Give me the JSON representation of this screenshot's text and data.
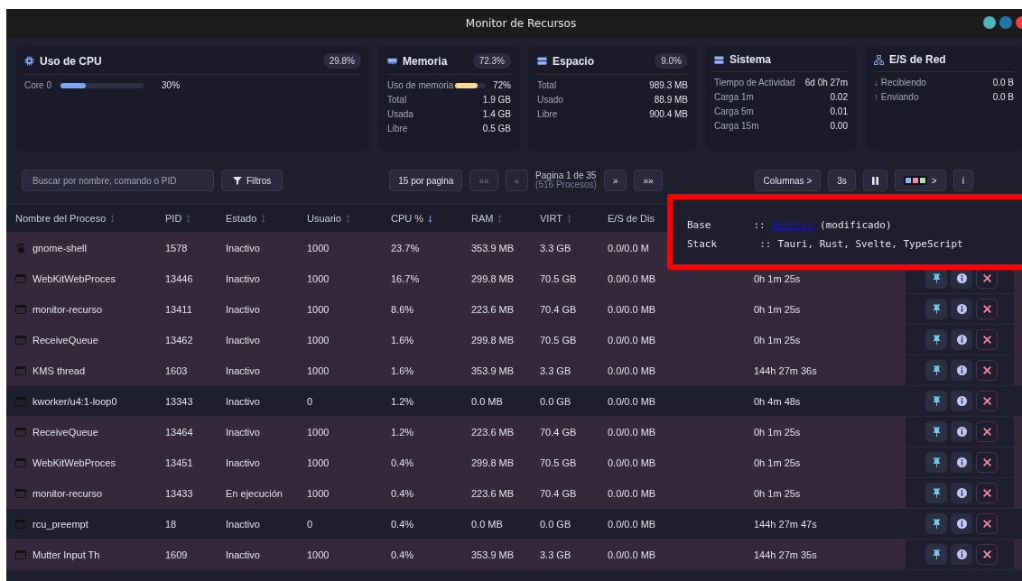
{
  "window": {
    "title": "Monitor de Recursos",
    "controls": [
      {
        "color": "#4fb3c0"
      },
      {
        "color": "#1f78a8"
      },
      {
        "color": "#f03c3c"
      }
    ]
  },
  "cards": [
    {
      "kind": "cpu",
      "title": "Uso de CPU",
      "badge": "29.8%",
      "bars": [
        {
          "label": "Core 0",
          "level": 0.3,
          "reading": "30%",
          "color": "#7aa8f0"
        }
      ]
    },
    {
      "kind": "memory",
      "title": "Memoria",
      "badge": "72.3%",
      "bars": [
        {
          "label": "Uso de memoria",
          "level": 0.72,
          "reading": "72%",
          "color": "#f5dc9b"
        }
      ],
      "rows": [
        {
          "label": "Total",
          "value": "1.9 GB"
        },
        {
          "label": "Usada",
          "value": "1.4 GB"
        },
        {
          "label": "Libre",
          "value": "0.5 GB"
        }
      ]
    },
    {
      "kind": "disk",
      "title": "Espacio",
      "badge": "9.0%",
      "rows": [
        {
          "label": "Total",
          "value": "989.3 MB"
        },
        {
          "label": "Usado",
          "value": "88.9 MB"
        },
        {
          "label": "Libre",
          "value": "900.4 MB"
        }
      ]
    },
    {
      "kind": "system",
      "title": "Sistema",
      "rows": [
        {
          "label": "Tiempo de Actividad",
          "value": "6d 0h 27m"
        },
        {
          "label": "Carga 1m",
          "value": "0.02"
        },
        {
          "label": "Carga 5m",
          "value": "0.01"
        },
        {
          "label": "Carga 15m",
          "value": "0.00"
        }
      ]
    },
    {
      "kind": "network",
      "title": "E/S de Red",
      "rows": [
        {
          "label": "↓ Recibiendo",
          "value": "0.0 B"
        },
        {
          "label": "↑ Enviando",
          "value": "0.0 B"
        }
      ]
    }
  ],
  "toolbar": {
    "search": {
      "placeholder": "Buscar por nombre, comando o PID"
    },
    "filters": "Filtros",
    "per_page": "15 por pagina",
    "first": "««",
    "prev": "«",
    "page": "Pagina 1 de 35",
    "count": "(516 Procesos)",
    "next": "»",
    "last": "»»",
    "columns": "Columnas >",
    "interval": "3s",
    "theme_caret": ">",
    "info": "i"
  },
  "table": {
    "columns": [
      {
        "label": "Nombre del Proceso",
        "sorted": false
      },
      {
        "label": "PID",
        "sorted": false
      },
      {
        "label": "Estado",
        "sorted": false
      },
      {
        "label": "Usuario",
        "sorted": false
      },
      {
        "label": "CPU %",
        "sorted": true
      },
      {
        "label": "RAM",
        "sorted": false
      },
      {
        "label": "VIRT",
        "sorted": false
      },
      {
        "label": "E/S de Dis"
      }
    ],
    "rows": [
      {
        "kind": "gnome",
        "name": "gnome-shell",
        "pid": "1578",
        "state": "Inactivo",
        "user": "1000",
        "cpu": "23.7%",
        "ram": "353.9 MB",
        "virt": "3.3 GB",
        "io": "0.0/0.0 M",
        "highlighted": true,
        "actions": false
      },
      {
        "kind": "window",
        "name": "WebKitWebProces",
        "pid": "13446",
        "state": "Inactivo",
        "user": "1000",
        "cpu": "16.7%",
        "ram": "299.8 MB",
        "virt": "70.5 GB",
        "io": "0.0/0.0 MB",
        "time": "0h 1m 25s",
        "highlighted": true,
        "actions": true
      },
      {
        "kind": "window",
        "name": "monitor-recurso",
        "pid": "13411",
        "state": "Inactivo",
        "user": "1000",
        "cpu": "8.6%",
        "ram": "223.6 MB",
        "virt": "70.4 GB",
        "io": "0.0/0.0 MB",
        "time": "0h 1m 25s",
        "highlighted": true,
        "actions": true
      },
      {
        "kind": "window",
        "name": "ReceiveQueue",
        "pid": "13462",
        "state": "Inactivo",
        "user": "1000",
        "cpu": "1.6%",
        "ram": "299.8 MB",
        "virt": "70.5 GB",
        "io": "0.0/0.0 MB",
        "time": "0h 1m 25s",
        "highlighted": true,
        "actions": true
      },
      {
        "kind": "window",
        "name": "KMS thread",
        "pid": "1603",
        "state": "Inactivo",
        "user": "1000",
        "cpu": "1.6%",
        "ram": "353.9 MB",
        "virt": "3.3 GB",
        "io": "0.0/0.0 MB",
        "time": "144h 27m 36s",
        "highlighted": true,
        "actions": true
      },
      {
        "kind": "window",
        "name": "kworker/u4:1-loop0",
        "pid": "13343",
        "state": "Inactivo",
        "user": "0",
        "cpu": "1.2%",
        "ram": "0.0 MB",
        "virt": "0.0 GB",
        "io": "0.0/0.0 MB",
        "time": "0h 4m 48s",
        "highlighted": false,
        "actions": true
      },
      {
        "kind": "window",
        "name": "ReceiveQueue",
        "pid": "13464",
        "state": "Inactivo",
        "user": "1000",
        "cpu": "1.2%",
        "ram": "223.6 MB",
        "virt": "70.4 GB",
        "io": "0.0/0.0 MB",
        "time": "0h 1m 25s",
        "highlighted": true,
        "actions": true
      },
      {
        "kind": "window",
        "name": "WebKitWebProces",
        "pid": "13451",
        "state": "Inactivo",
        "user": "1000",
        "cpu": "0.4%",
        "ram": "299.8 MB",
        "virt": "70.5 GB",
        "io": "0.0/0.0 MB",
        "time": "0h 1m 25s",
        "highlighted": true,
        "actions": true
      },
      {
        "kind": "window",
        "name": "monitor-recurso",
        "pid": "13433",
        "state": "En ejecución",
        "user": "1000",
        "cpu": "0.4%",
        "ram": "223.6 MB",
        "virt": "70.4 GB",
        "io": "0.0/0.0 MB",
        "time": "0h 1m 25s",
        "highlighted": true,
        "actions": true
      },
      {
        "kind": "window",
        "name": "rcu_preempt",
        "pid": "18",
        "state": "Inactivo",
        "user": "0",
        "cpu": "0.4%",
        "ram": "0.0 MB",
        "virt": "0.0 GB",
        "io": "0.0/0.0 MB",
        "time": "144h 27m 47s",
        "highlighted": false,
        "actions": true
      },
      {
        "kind": "window",
        "name": "Mutter Input Th",
        "pid": "1609",
        "state": "Inactivo",
        "user": "1000",
        "cpu": "0.4%",
        "ram": "353.9 MB",
        "virt": "3.3 GB",
        "io": "0.0/0.0 MB",
        "time": "144h 27m 35s",
        "highlighted": true,
        "actions": true
      }
    ]
  },
  "about": {
    "rows": [
      {
        "key": "Base",
        "sep": "::",
        "link": "NeoHtop",
        "text": "(modificado)"
      },
      {
        "key": "Stack",
        "sep": "::",
        "text": "Tauri, Rust, Svelte, TypeScript"
      }
    ]
  }
}
